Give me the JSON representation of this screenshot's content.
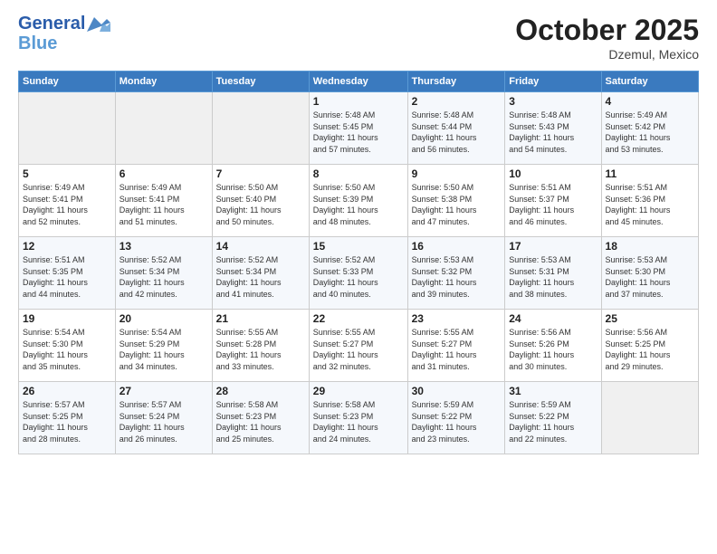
{
  "header": {
    "logo_line1": "General",
    "logo_line2": "Blue",
    "month": "October 2025",
    "location": "Dzemul, Mexico"
  },
  "weekdays": [
    "Sunday",
    "Monday",
    "Tuesday",
    "Wednesday",
    "Thursday",
    "Friday",
    "Saturday"
  ],
  "weeks": [
    [
      {
        "day": "",
        "info": ""
      },
      {
        "day": "",
        "info": ""
      },
      {
        "day": "",
        "info": ""
      },
      {
        "day": "1",
        "info": "Sunrise: 5:48 AM\nSunset: 5:45 PM\nDaylight: 11 hours\nand 57 minutes."
      },
      {
        "day": "2",
        "info": "Sunrise: 5:48 AM\nSunset: 5:44 PM\nDaylight: 11 hours\nand 56 minutes."
      },
      {
        "day": "3",
        "info": "Sunrise: 5:48 AM\nSunset: 5:43 PM\nDaylight: 11 hours\nand 54 minutes."
      },
      {
        "day": "4",
        "info": "Sunrise: 5:49 AM\nSunset: 5:42 PM\nDaylight: 11 hours\nand 53 minutes."
      }
    ],
    [
      {
        "day": "5",
        "info": "Sunrise: 5:49 AM\nSunset: 5:41 PM\nDaylight: 11 hours\nand 52 minutes."
      },
      {
        "day": "6",
        "info": "Sunrise: 5:49 AM\nSunset: 5:41 PM\nDaylight: 11 hours\nand 51 minutes."
      },
      {
        "day": "7",
        "info": "Sunrise: 5:50 AM\nSunset: 5:40 PM\nDaylight: 11 hours\nand 50 minutes."
      },
      {
        "day": "8",
        "info": "Sunrise: 5:50 AM\nSunset: 5:39 PM\nDaylight: 11 hours\nand 48 minutes."
      },
      {
        "day": "9",
        "info": "Sunrise: 5:50 AM\nSunset: 5:38 PM\nDaylight: 11 hours\nand 47 minutes."
      },
      {
        "day": "10",
        "info": "Sunrise: 5:51 AM\nSunset: 5:37 PM\nDaylight: 11 hours\nand 46 minutes."
      },
      {
        "day": "11",
        "info": "Sunrise: 5:51 AM\nSunset: 5:36 PM\nDaylight: 11 hours\nand 45 minutes."
      }
    ],
    [
      {
        "day": "12",
        "info": "Sunrise: 5:51 AM\nSunset: 5:35 PM\nDaylight: 11 hours\nand 44 minutes."
      },
      {
        "day": "13",
        "info": "Sunrise: 5:52 AM\nSunset: 5:34 PM\nDaylight: 11 hours\nand 42 minutes."
      },
      {
        "day": "14",
        "info": "Sunrise: 5:52 AM\nSunset: 5:34 PM\nDaylight: 11 hours\nand 41 minutes."
      },
      {
        "day": "15",
        "info": "Sunrise: 5:52 AM\nSunset: 5:33 PM\nDaylight: 11 hours\nand 40 minutes."
      },
      {
        "day": "16",
        "info": "Sunrise: 5:53 AM\nSunset: 5:32 PM\nDaylight: 11 hours\nand 39 minutes."
      },
      {
        "day": "17",
        "info": "Sunrise: 5:53 AM\nSunset: 5:31 PM\nDaylight: 11 hours\nand 38 minutes."
      },
      {
        "day": "18",
        "info": "Sunrise: 5:53 AM\nSunset: 5:30 PM\nDaylight: 11 hours\nand 37 minutes."
      }
    ],
    [
      {
        "day": "19",
        "info": "Sunrise: 5:54 AM\nSunset: 5:30 PM\nDaylight: 11 hours\nand 35 minutes."
      },
      {
        "day": "20",
        "info": "Sunrise: 5:54 AM\nSunset: 5:29 PM\nDaylight: 11 hours\nand 34 minutes."
      },
      {
        "day": "21",
        "info": "Sunrise: 5:55 AM\nSunset: 5:28 PM\nDaylight: 11 hours\nand 33 minutes."
      },
      {
        "day": "22",
        "info": "Sunrise: 5:55 AM\nSunset: 5:27 PM\nDaylight: 11 hours\nand 32 minutes."
      },
      {
        "day": "23",
        "info": "Sunrise: 5:55 AM\nSunset: 5:27 PM\nDaylight: 11 hours\nand 31 minutes."
      },
      {
        "day": "24",
        "info": "Sunrise: 5:56 AM\nSunset: 5:26 PM\nDaylight: 11 hours\nand 30 minutes."
      },
      {
        "day": "25",
        "info": "Sunrise: 5:56 AM\nSunset: 5:25 PM\nDaylight: 11 hours\nand 29 minutes."
      }
    ],
    [
      {
        "day": "26",
        "info": "Sunrise: 5:57 AM\nSunset: 5:25 PM\nDaylight: 11 hours\nand 28 minutes."
      },
      {
        "day": "27",
        "info": "Sunrise: 5:57 AM\nSunset: 5:24 PM\nDaylight: 11 hours\nand 26 minutes."
      },
      {
        "day": "28",
        "info": "Sunrise: 5:58 AM\nSunset: 5:23 PM\nDaylight: 11 hours\nand 25 minutes."
      },
      {
        "day": "29",
        "info": "Sunrise: 5:58 AM\nSunset: 5:23 PM\nDaylight: 11 hours\nand 24 minutes."
      },
      {
        "day": "30",
        "info": "Sunrise: 5:59 AM\nSunset: 5:22 PM\nDaylight: 11 hours\nand 23 minutes."
      },
      {
        "day": "31",
        "info": "Sunrise: 5:59 AM\nSunset: 5:22 PM\nDaylight: 11 hours\nand 22 minutes."
      },
      {
        "day": "",
        "info": ""
      }
    ]
  ]
}
